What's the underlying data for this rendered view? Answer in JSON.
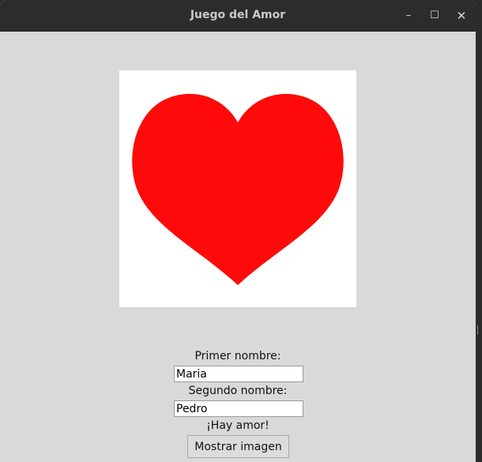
{
  "window": {
    "title": "Juego del Amor",
    "controls": {
      "minimize": "–",
      "maximize": "☐",
      "close": "✕"
    }
  },
  "canvas": {
    "heart_color": "#ff0a0a",
    "background": "#ffffff"
  },
  "form": {
    "first_label": "Primer nombre:",
    "first_value": "Maria",
    "second_label": "Segundo nombre:",
    "second_value": "Pedro",
    "result_text": "¡Hay amor!",
    "button_label": "Mostrar imagen"
  }
}
